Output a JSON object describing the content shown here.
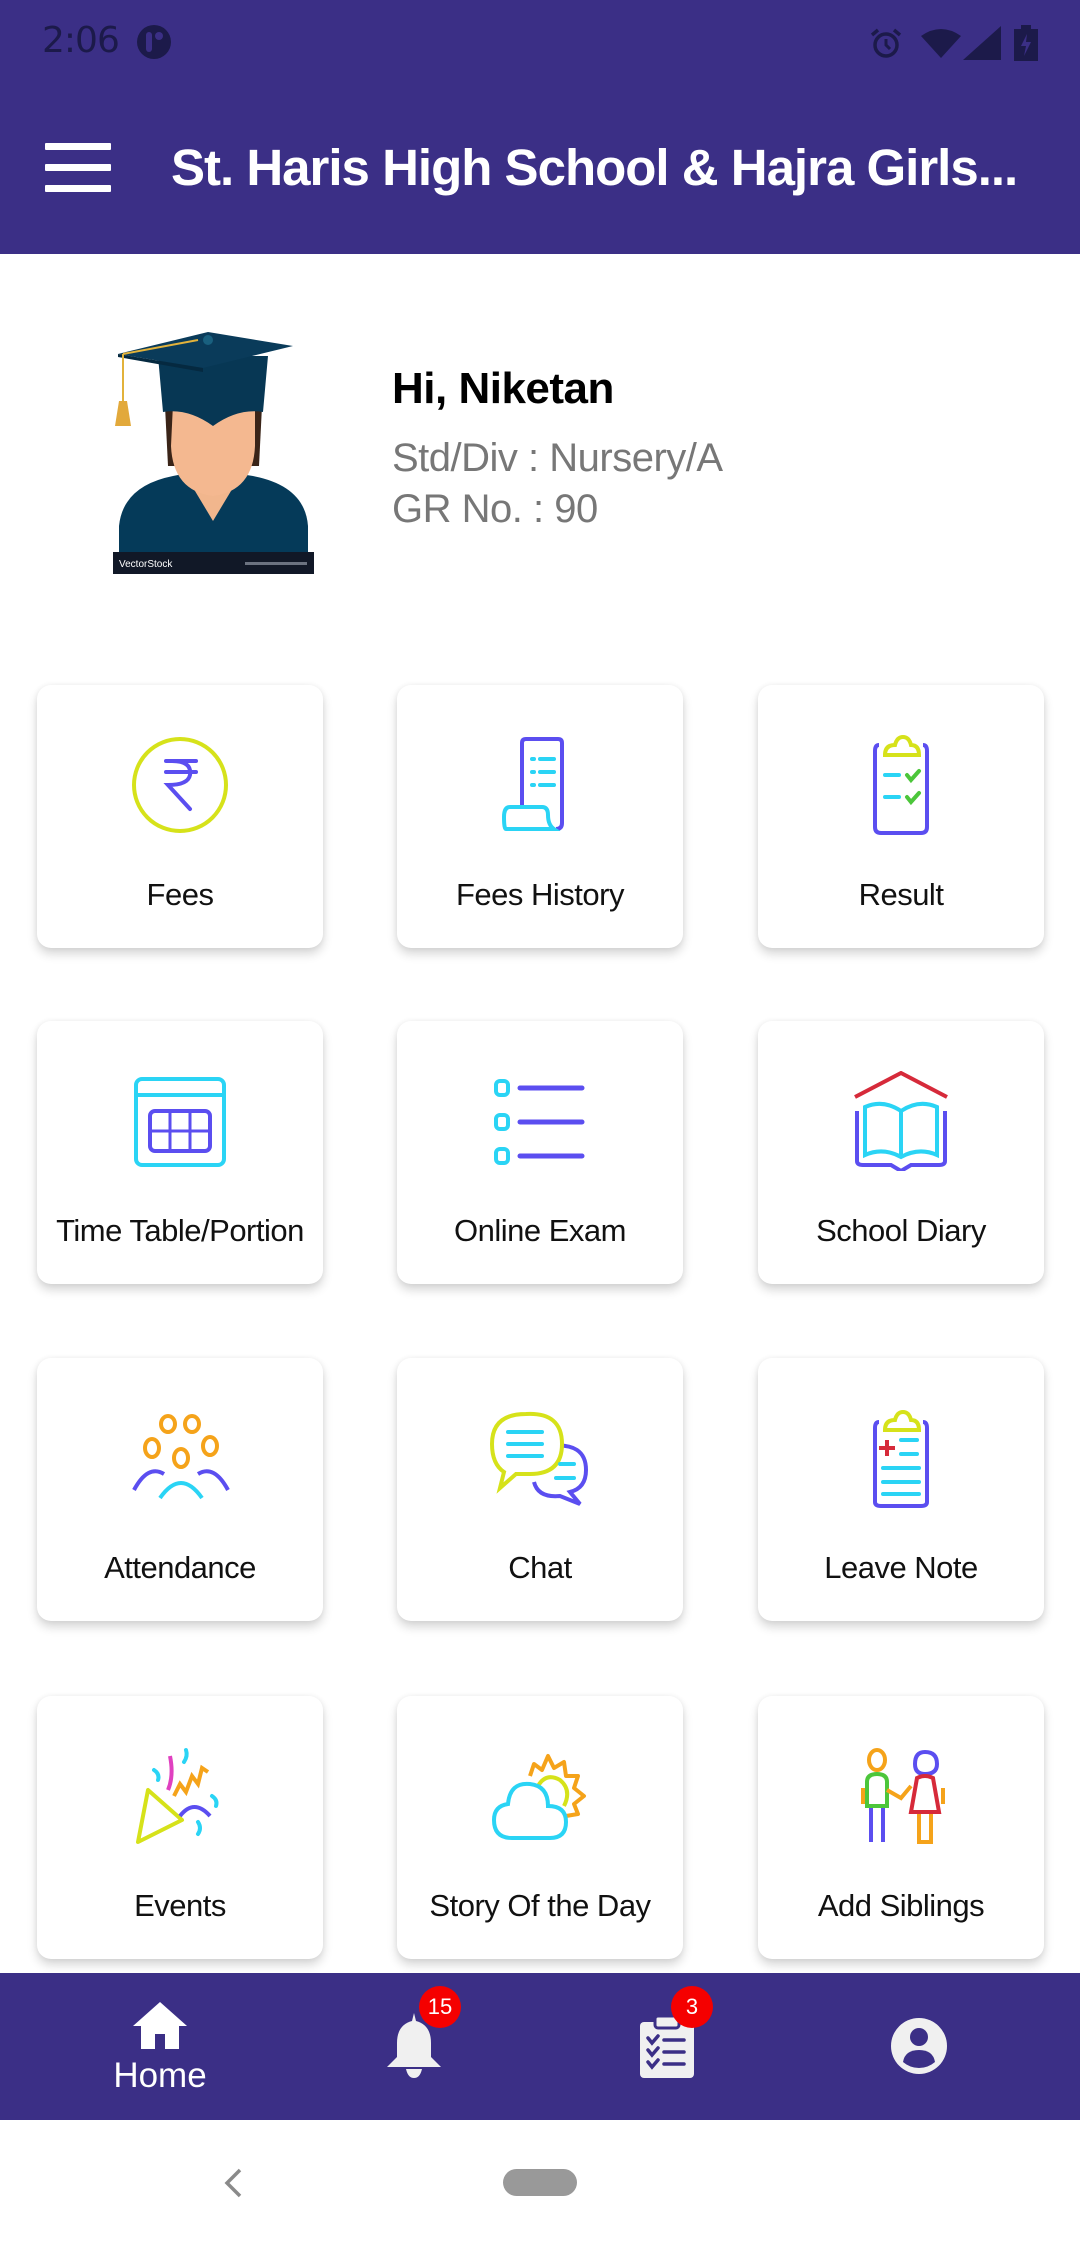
{
  "status_bar": {
    "time": "2:06",
    "left_icons": [
      "app-notification-icon"
    ],
    "right_icons": [
      "alarm-icon",
      "wifi-icon",
      "cellular-signal-icon",
      "battery-charging-icon"
    ]
  },
  "app_bar": {
    "menu_icon": "hamburger-menu-icon",
    "title": "St. Haris High School   & Hajra Girls..."
  },
  "profile": {
    "avatar": "graduate-student-avatar",
    "avatar_watermark": "VectorStock",
    "greeting": "Hi, Niketan",
    "std_div": "Std/Div : Nursery/A",
    "gr_no": "GR No. : 90"
  },
  "menu": {
    "items": [
      {
        "label": "Fees",
        "icon": "rupee-coin-icon"
      },
      {
        "label": "Fees History",
        "icon": "receipt-scroll-icon"
      },
      {
        "label": "Result",
        "icon": "clipboard-check-icon"
      },
      {
        "label": "Time Table/Portion",
        "icon": "calendar-grid-icon"
      },
      {
        "label": "Online Exam",
        "icon": "checklist-icon"
      },
      {
        "label": "School Diary",
        "icon": "open-book-icon"
      },
      {
        "label": "Attendance",
        "icon": "group-people-icon"
      },
      {
        "label": "Chat",
        "icon": "chat-bubbles-icon"
      },
      {
        "label": "Leave Note",
        "icon": "medical-clipboard-icon"
      },
      {
        "label": "Events",
        "icon": "party-popper-icon"
      },
      {
        "label": "Story Of the Day",
        "icon": "sun-cloud-icon"
      },
      {
        "label": "Add Siblings",
        "icon": "siblings-icon"
      }
    ]
  },
  "bottom_nav": {
    "home": {
      "label": "Home",
      "icon": "home-icon",
      "active": true
    },
    "notifications": {
      "icon": "bell-icon",
      "badge": "15"
    },
    "tasks": {
      "icon": "clipboard-list-icon",
      "badge": "3"
    },
    "profile": {
      "icon": "account-circle-icon"
    }
  },
  "system_nav": {
    "back": "back-chevron-icon",
    "home": "home-pill"
  },
  "colors": {
    "primary": "#3b2f86",
    "badge": "#f50000",
    "secondary_text": "#777777"
  }
}
